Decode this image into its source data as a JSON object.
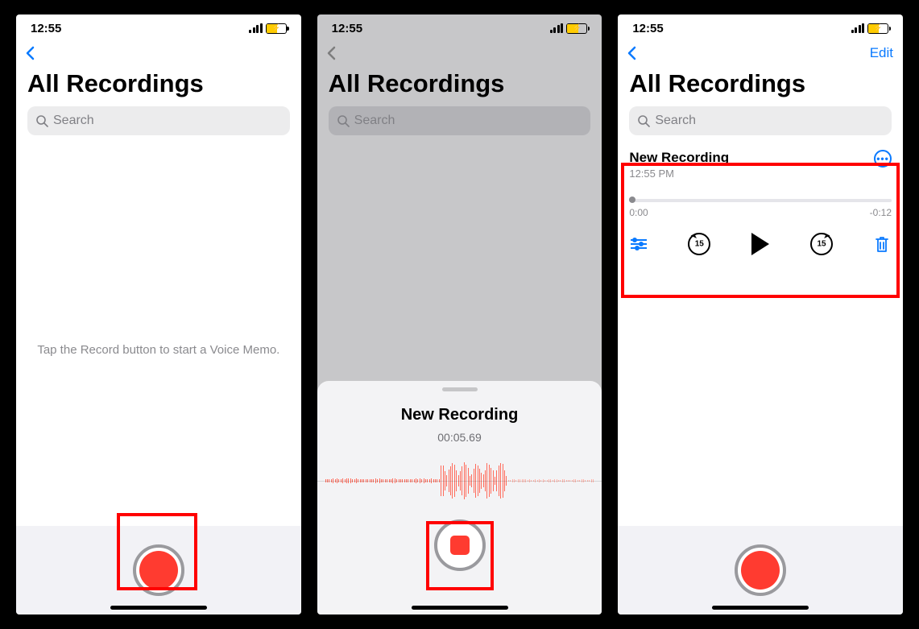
{
  "status": {
    "time": "12:55"
  },
  "nav": {
    "edit": "Edit"
  },
  "header": {
    "title": "All Recordings"
  },
  "search": {
    "placeholder": "Search"
  },
  "screen1": {
    "hint": "Tap the Record button to start a Voice Memo."
  },
  "screen2": {
    "recording_title": "New Recording",
    "elapsed": "00:05.69"
  },
  "screen3": {
    "item": {
      "title": "New Recording",
      "subtitle": "12:55 PM",
      "pos": "0:00",
      "remain": "-0:12",
      "skip_seconds": "15"
    }
  }
}
